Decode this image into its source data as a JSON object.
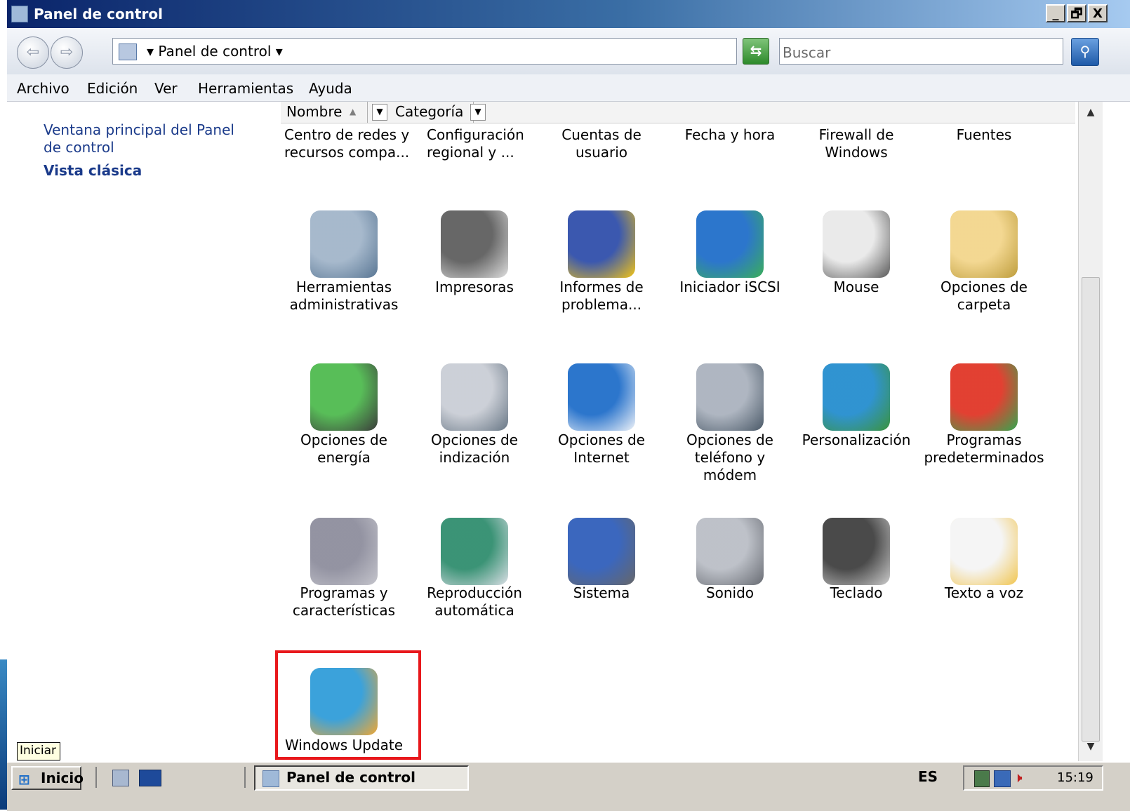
{
  "window": {
    "title": "Panel de control",
    "minimize": "_",
    "maximize": "🗗",
    "close": "X"
  },
  "addressbar": {
    "crumb": "▾ Panel de control ▾",
    "search_placeholder": "Buscar"
  },
  "menu": [
    "Archivo",
    "Edición",
    "Ver",
    "Herramientas",
    "Ayuda"
  ],
  "leftpane": {
    "home_link": "Ventana principal del Panel de control",
    "classic_view": "Vista clásica"
  },
  "columns": {
    "name": "Nombre",
    "category": "Categoría"
  },
  "items_row0": [
    "Centro de redes y recursos compa...",
    "Configuración regional y ...",
    "Cuentas de usuario",
    "Fecha y hora",
    "Firewall de Windows",
    "Fuentes"
  ],
  "items": [
    {
      "label_1": "Herramientas",
      "label_2": "administrativas",
      "icon": "admin-tools-icon"
    },
    {
      "label_1": "Impresoras",
      "label_2": "",
      "icon": "printer-icon"
    },
    {
      "label_1": "Informes de",
      "label_2": "problema...",
      "icon": "problem-reports-icon"
    },
    {
      "label_1": "Iniciador iSCSI",
      "label_2": "",
      "icon": "iscsi-globe-icon"
    },
    {
      "label_1": "Mouse",
      "label_2": "",
      "icon": "mouse-icon"
    },
    {
      "label_1": "Opciones de",
      "label_2": "carpeta",
      "icon": "folder-options-icon"
    },
    {
      "label_1": "Opciones de",
      "label_2": "energía",
      "icon": "power-options-icon"
    },
    {
      "label_1": "Opciones de",
      "label_2": "indización",
      "icon": "indexing-options-icon"
    },
    {
      "label_1": "Opciones de",
      "label_2": "Internet",
      "icon": "internet-options-icon"
    },
    {
      "label_1": "Opciones de",
      "label_2": "teléfono y módem",
      "icon": "phone-modem-icon"
    },
    {
      "label_1": "Personalización",
      "label_2": "",
      "icon": "personalization-icon"
    },
    {
      "label_1": "Programas",
      "label_2": "predeterminados",
      "icon": "default-programs-icon"
    },
    {
      "label_1": "Programas y",
      "label_2": "características",
      "icon": "programs-features-icon"
    },
    {
      "label_1": "Reproducción",
      "label_2": "automática",
      "icon": "autoplay-icon"
    },
    {
      "label_1": "Sistema",
      "label_2": "",
      "icon": "system-icon"
    },
    {
      "label_1": "Sonido",
      "label_2": "",
      "icon": "sound-icon"
    },
    {
      "label_1": "Teclado",
      "label_2": "",
      "icon": "keyboard-icon"
    },
    {
      "label_1": "Texto a voz",
      "label_2": "",
      "icon": "text-to-speech-icon"
    },
    {
      "label_1": "Windows Update",
      "label_2": "",
      "icon": "windows-update-icon"
    }
  ],
  "taskbar": {
    "start_label": "Inicio",
    "tooltip": "Iniciar",
    "task_label": "Panel de control",
    "language": "ES",
    "clock": "15:19"
  },
  "colors": {
    "highlight": "#e8181c",
    "link": "#1a3a8a"
  }
}
